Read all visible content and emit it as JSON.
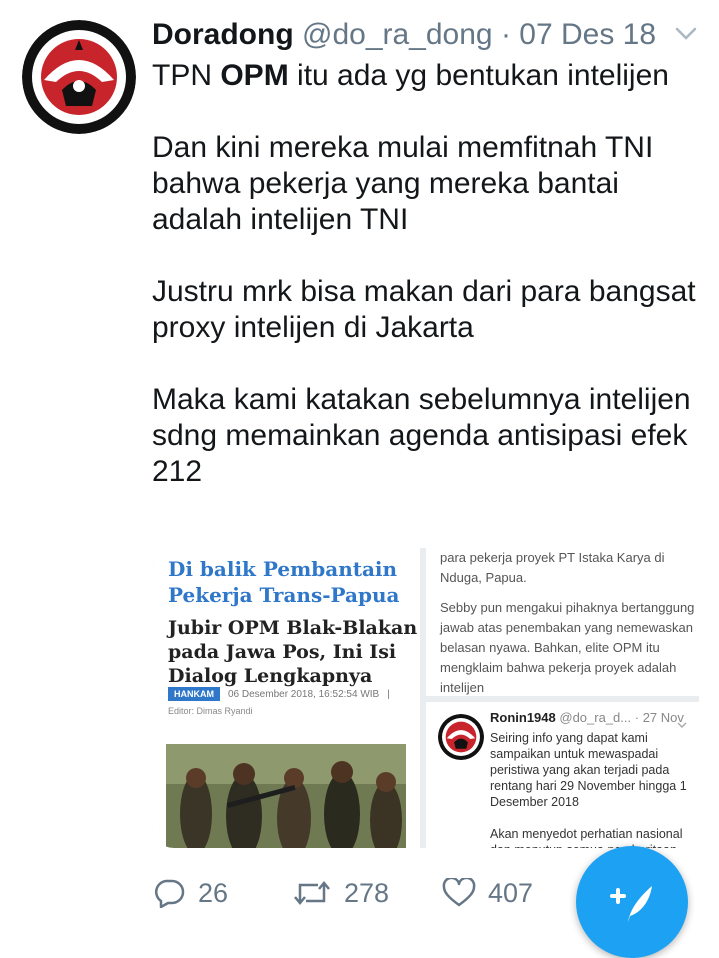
{
  "tweet": {
    "display_name": "Doradong",
    "handle": "@do_ra_dong",
    "separator": "·",
    "date": "07 Des 18",
    "line1_before": "TPN ",
    "line1_bold": "OPM",
    "line1_after": " itu ada yg bentukan intelijen",
    "para2": "Dan kini mereka mulai memfitnah TNI\nbahwa pekerja yang mereka bantai\nadalah intelijen TNI",
    "para3": "Justru mrk bisa makan dari para bangsat\nproxy intelijen di Jakarta",
    "para4": "Maka kami katakan sebelumnya intelijen\nsdng memainkan agenda antisipasi efek\n212"
  },
  "media": {
    "left": {
      "headline_blue": "Di balik Pembantain\nPekerja Trans-Papua",
      "headline_black": "Jubir OPM Blak-Blakan\npada Jawa Pos, Ini Isi\nDialog Lengkapnya",
      "tag": "HANKAM",
      "timestamp": "06 Desember 2018, 16:52:54 WIB",
      "pipe": "|",
      "editor": "Editor: Dimas Ryandi"
    },
    "right_top": {
      "para1": "para pekerja proyek PT Istaka Karya di Nduga, Papua.",
      "para2": "Sebby pun mengakui pihaknya bertanggung jawab atas penembakan yang nemewaskan belasan nyawa. Bahkan, elite OPM itu mengklaim bahwa pekerja proyek adalah intelijen"
    },
    "right_bottom": {
      "name": "Ronin1948",
      "handle": "@do_ra_d...",
      "date": "· 27 Nov",
      "para1": "Seiring info yang dapat kami sampaikan untuk mewaspadai peristiwa yang akan terjadi pada rentang hari 29 November hingga 1 Desember 2018",
      "para2": "Akan menyedot perhatian nasional dan menutup semua pemberitaan"
    }
  },
  "actions": {
    "replies": "26",
    "retweets": "278",
    "likes": "407"
  },
  "colors": {
    "text": "#14171a",
    "muted": "#657786",
    "accent": "#1da1f2"
  },
  "icons": [
    "chevron-down-icon",
    "reply-icon",
    "retweet-icon",
    "like-icon",
    "compose-icon"
  ]
}
